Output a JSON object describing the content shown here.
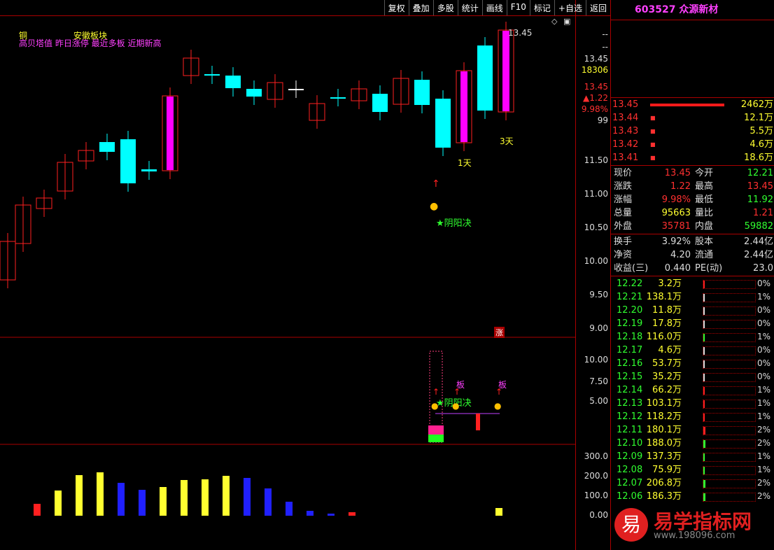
{
  "toolbar": {
    "items": [
      "复权",
      "叠加",
      "多股",
      "统计",
      "画线",
      "F10",
      "标记",
      "+自选",
      "返回"
    ]
  },
  "stock": {
    "code": "603527",
    "name": "众源新材"
  },
  "chart_header": {
    "line1_a": "铜",
    "line1_b": "安徽板块",
    "line2": "高贝塔值 昨日涨停 最近多板 近期新高"
  },
  "annotations": {
    "high_label": "13.45",
    "day1": "1天",
    "day3": "3天",
    "yinyang": "★阴阳决",
    "limit_up": "涨",
    "ban1": "板",
    "ban2": "板",
    "yinyang2": "★阴阳决"
  },
  "axis_main": {
    "top_labels": [
      "--",
      "--",
      "13.45",
      "18306",
      "13.45",
      "▲1.22",
      "9.98%",
      "99"
    ],
    "ticks": [
      "11.50",
      "11.00",
      "10.50",
      "10.00",
      "9.50",
      "9.00"
    ]
  },
  "axis_mid": {
    "ticks": [
      "10.00",
      "7.50",
      "5.00"
    ]
  },
  "axis_bottom": {
    "ticks": [
      "300.0",
      "200.0",
      "100.0",
      "0.00"
    ]
  },
  "asks": [
    {
      "price": "13.45",
      "vol": "2462万"
    },
    {
      "price": "13.44",
      "vol": "12.1万"
    },
    {
      "price": "13.43",
      "vol": "5.5万"
    },
    {
      "price": "13.42",
      "vol": "4.6万"
    },
    {
      "price": "13.41",
      "vol": "18.6万"
    }
  ],
  "quote": [
    {
      "l1": "现价",
      "v1": "13.45",
      "c1": "#ff3030",
      "l2": "今开",
      "v2": "12.21",
      "c2": "#30ff30"
    },
    {
      "l1": "涨跌",
      "v1": "1.22",
      "c1": "#ff3030",
      "l2": "最高",
      "v2": "13.45",
      "c2": "#ff3030"
    },
    {
      "l1": "涨幅",
      "v1": "9.98%",
      "c1": "#ff3030",
      "l2": "最低",
      "v2": "11.92",
      "c2": "#30ff30"
    },
    {
      "l1": "总量",
      "v1": "95663",
      "c1": "#ffff30",
      "l2": "量比",
      "v2": "1.21",
      "c2": "#ff3030"
    },
    {
      "l1": "外盘",
      "v1": "35781",
      "c1": "#ff3030",
      "l2": "内盘",
      "v2": "59882",
      "c2": "#30ff30"
    }
  ],
  "fund": [
    {
      "l1": "换手",
      "v1": "3.92%",
      "l2": "股本",
      "v2": "2.44亿"
    },
    {
      "l1": "净资",
      "v1": "4.20",
      "l2": "流通",
      "v2": "2.44亿"
    },
    {
      "l1": "收益(三)",
      "v1": "0.440",
      "l2": "PE(动)",
      "v2": "23.0"
    }
  ],
  "levels": [
    {
      "price": "12.22",
      "vol": "3.2万",
      "pct": "0%",
      "fill": 0.0,
      "color": "#ff2020"
    },
    {
      "price": "12.21",
      "vol": "138.1万",
      "pct": "1%",
      "fill": 0.02,
      "color": "#ddd"
    },
    {
      "price": "12.20",
      "vol": "11.8万",
      "pct": "0%",
      "fill": 0.0,
      "color": "#ddd"
    },
    {
      "price": "12.19",
      "vol": "17.8万",
      "pct": "0%",
      "fill": 0.0,
      "color": "#ddd"
    },
    {
      "price": "12.18",
      "vol": "116.0万",
      "pct": "1%",
      "fill": 0.03,
      "color": "#30ff30"
    },
    {
      "price": "12.17",
      "vol": "4.6万",
      "pct": "0%",
      "fill": 0.0,
      "color": "#ddd"
    },
    {
      "price": "12.16",
      "vol": "53.7万",
      "pct": "0%",
      "fill": 0.0,
      "color": "#ddd"
    },
    {
      "price": "12.15",
      "vol": "35.2万",
      "pct": "0%",
      "fill": 0.0,
      "color": "#ddd"
    },
    {
      "price": "12.14",
      "vol": "66.2万",
      "pct": "1%",
      "fill": 0.02,
      "color": "#ff2020"
    },
    {
      "price": "12.13",
      "vol": "103.1万",
      "pct": "1%",
      "fill": 0.03,
      "color": "#ff2020"
    },
    {
      "price": "12.12",
      "vol": "118.2万",
      "pct": "1%",
      "fill": 0.03,
      "color": "#ff2020"
    },
    {
      "price": "12.11",
      "vol": "180.1万",
      "pct": "2%",
      "fill": 0.04,
      "color": "#ff2020"
    },
    {
      "price": "12.10",
      "vol": "188.0万",
      "pct": "2%",
      "fill": 0.04,
      "color": "#30ff30"
    },
    {
      "price": "12.09",
      "vol": "137.3万",
      "pct": "1%",
      "fill": 0.03,
      "color": "#30ff30"
    },
    {
      "price": "12.08",
      "vol": "75.9万",
      "pct": "1%",
      "fill": 0.02,
      "color": "#30ff30"
    },
    {
      "price": "12.07",
      "vol": "206.8万",
      "pct": "2%",
      "fill": 0.04,
      "color": "#30ff30"
    },
    {
      "price": "12.06",
      "vol": "186.3万",
      "pct": "2%",
      "fill": 0.04,
      "color": "#30ff30"
    }
  ],
  "watermark": {
    "char": "易",
    "text": "易学指标网",
    "url": "www.198096.com"
  },
  "colors": {
    "up": "#ff2020",
    "down": "#00ffff",
    "limit": "#ff00ff",
    "accent": "#ffff30"
  }
}
